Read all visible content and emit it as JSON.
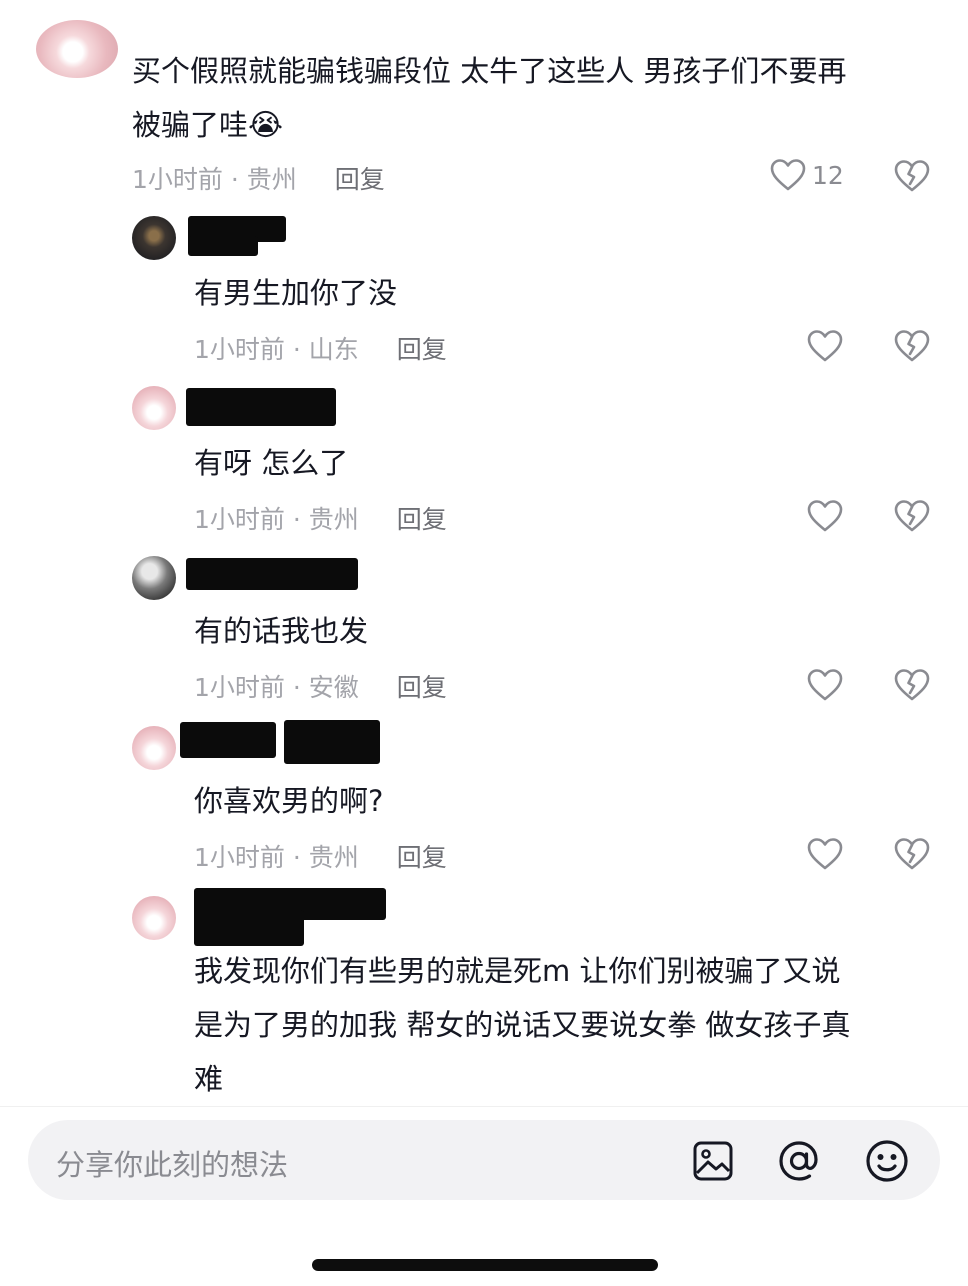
{
  "comment_main": {
    "text_line1": "买个假照就能骗钱骗段位 太牛了这些人 男孩子们不要再",
    "text_line2": "被骗了哇",
    "emoji": "😭",
    "time": "1小时前 · 贵州",
    "reply_label": "回复",
    "like_count": "12"
  },
  "replies": [
    {
      "text": "有男生加你了没",
      "time": "1小时前 · 山东",
      "reply_label": "回复"
    },
    {
      "text": "有呀 怎么了",
      "time": "1小时前 · 贵州",
      "reply_label": "回复"
    },
    {
      "text": "有的话我也发",
      "time": "1小时前 · 安徽",
      "reply_label": "回复"
    },
    {
      "text": "你喜欢男的啊?",
      "time": "1小时前 · 贵州",
      "reply_label": "回复"
    },
    {
      "text_line1": "我发现你们有些男的就是死m 让你们别被骗了又说",
      "text_line2": "是为了男的加我 帮女的说话又要说女拳 做女孩子真",
      "text_line3": "难"
    }
  ],
  "input": {
    "placeholder": "分享你此刻的想法"
  },
  "icons": {
    "like": "heart-icon",
    "dislike": "broken-heart-icon",
    "image": "image-icon",
    "mention": "at-icon",
    "emoji": "smiley-icon"
  }
}
